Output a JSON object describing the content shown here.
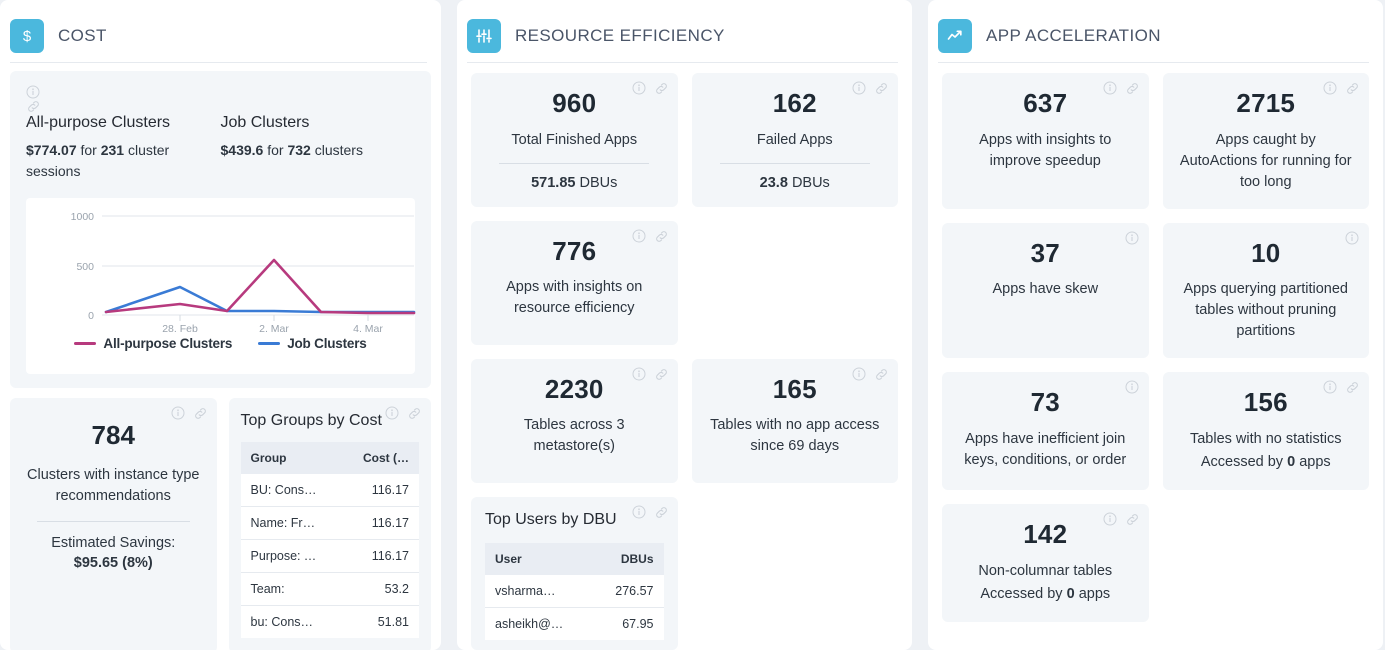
{
  "panels": {
    "cost": {
      "title": "COST",
      "icon": "dollar-icon",
      "accent": "#4bb8dd",
      "clusters": {
        "all_purpose": {
          "title": "All-purpose Clusters",
          "amount": "$774.07",
          "for": "for",
          "count": "231",
          "unit": "cluster sessions"
        },
        "job": {
          "title": "Job Clusters",
          "amount": "$439.6",
          "for": "for",
          "count": "732",
          "unit": "clusters"
        }
      },
      "recommendations": {
        "value": "784",
        "label": "Clusters with instance type recommendations",
        "savings_label": "Estimated Savings:",
        "savings_value": "$95.65 (8%)"
      },
      "top_groups": {
        "title": "Top Groups by Cost",
        "columns": [
          "Group",
          "Cost (…"
        ],
        "rows": [
          [
            "BU: Consume…",
            "116.17"
          ],
          [
            "Name: Fraud-…",
            "116.17"
          ],
          [
            "Purpose: Tran…",
            "116.17"
          ],
          [
            "Team:",
            "53.2"
          ],
          [
            "bu: Consumer…",
            "51.81"
          ]
        ]
      }
    },
    "resource": {
      "title": "RESOURCE EFFICIENCY",
      "icon": "sliders-icon",
      "accent": "#4bb8dd",
      "tiles": [
        {
          "value": "960",
          "label": "Total Finished Apps",
          "sub_value": "571.85",
          "sub_unit": "DBUs",
          "has_info": true,
          "has_link": true
        },
        {
          "value": "162",
          "label": "Failed Apps",
          "sub_value": "23.8",
          "sub_unit": "DBUs",
          "has_info": true,
          "has_link": true
        },
        {
          "value": "776",
          "label": "Apps with insights on resource efficiency",
          "has_info": true,
          "has_link": true
        },
        {
          "value": "2230",
          "label": "Tables across 3 metastore(s)",
          "has_info": true,
          "has_link": true
        },
        {
          "value": "165",
          "label": "Tables with no app access since 69 days",
          "has_info": true,
          "has_link": true
        }
      ],
      "top_users": {
        "title": "Top Users by DBU",
        "columns": [
          "User",
          "DBUs"
        ],
        "rows": [
          [
            "vsharma@unr…",
            "276.57"
          ],
          [
            "asheikh@unra…",
            "67.95"
          ]
        ]
      }
    },
    "app": {
      "title": "APP ACCELERATION",
      "icon": "trend-up-icon",
      "accent": "#4bb8dd",
      "tiles": [
        {
          "value": "637",
          "label": "Apps with insights to improve speedup",
          "has_info": true,
          "has_link": true
        },
        {
          "value": "2715",
          "label": "Apps caught by AutoActions for running for too long",
          "has_info": true,
          "has_link": true
        },
        {
          "value": "37",
          "label": "Apps have skew",
          "has_info": true,
          "has_link": false
        },
        {
          "value": "10",
          "label": "Apps querying partitioned tables without pruning partitions",
          "has_info": true,
          "has_link": false
        },
        {
          "value": "73",
          "label": "Apps have inefficient join keys, conditions, or order",
          "has_info": true,
          "has_link": false
        },
        {
          "value": "156",
          "label": "Tables with no statistics",
          "sub_prefix": "Accessed by",
          "sub_value": "0",
          "sub_suffix": "apps",
          "has_info": true,
          "has_link": true
        },
        {
          "value": "142",
          "label": "Non-columnar tables",
          "sub_prefix": "Accessed by",
          "sub_value": "0",
          "sub_suffix": "apps",
          "has_info": true,
          "has_link": true
        }
      ]
    }
  },
  "chart_data": {
    "type": "line",
    "title": "",
    "xlabel": "",
    "ylabel": "",
    "ylim": [
      0,
      1000
    ],
    "yticks": [
      0,
      500,
      1000
    ],
    "ytick_labels": [
      "0",
      "500",
      "1000"
    ],
    "xtick_labels": [
      "28. Feb",
      "2. Mar",
      "4. Mar"
    ],
    "grid": true,
    "legend_position": "bottom",
    "x": [
      "27. Feb",
      "28. Feb",
      "1. Mar",
      "2. Mar",
      "3. Mar",
      "4. Mar",
      "5. Mar"
    ],
    "series": [
      {
        "name": "All-purpose Clusters",
        "color": "#b73a7e",
        "values": [
          30,
          110,
          45,
          565,
          35,
          25,
          20
        ]
      },
      {
        "name": "Job Clusters",
        "color": "#3a7bd5",
        "values": [
          25,
          280,
          45,
          42,
          40,
          38,
          36
        ]
      }
    ]
  }
}
